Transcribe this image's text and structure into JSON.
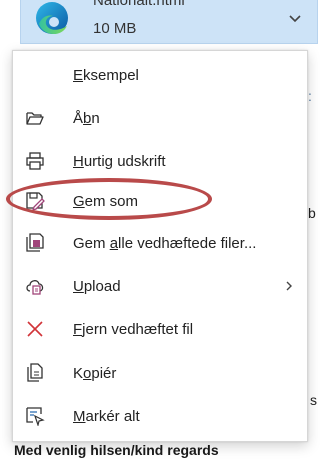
{
  "attachment": {
    "file_name": "Nationalt.html",
    "file_size": "10 MB",
    "icon": "edge-icon",
    "chevron": "chevron-down-icon"
  },
  "background": {
    "fragments": [
      "b",
      ":",
      "s"
    ],
    "signature": "Med venlig hilsen/kind regards"
  },
  "menu": {
    "items": [
      {
        "pre": "",
        "u": "E",
        "post": "ksempel",
        "icon": ""
      },
      {
        "pre": "Å",
        "u": "b",
        "post": "n",
        "icon": "folder-open-icon"
      },
      {
        "pre": "",
        "u": "H",
        "post": "urtig udskrift",
        "icon": "printer-icon"
      },
      {
        "pre": "",
        "u": "G",
        "post": "em som",
        "icon": "save-as-icon"
      },
      {
        "pre": "Gem ",
        "u": "a",
        "post": "lle vedhæftede filer...",
        "icon": "save-all-icon"
      },
      {
        "pre": "",
        "u": "U",
        "post": "pload",
        "icon": "upload-icon",
        "submenu": true
      },
      {
        "pre": "",
        "u": "F",
        "post": "jern vedhæftet fil",
        "icon": "remove-icon"
      },
      {
        "pre": "K",
        "u": "o",
        "post": "piér",
        "icon": "copy-icon"
      },
      {
        "pre": "",
        "u": "M",
        "post": "arkér alt",
        "icon": "select-all-icon"
      }
    ]
  },
  "colors": {
    "annotation": "#b94a4a",
    "attachment_bg": "#cde3f7",
    "remove_icon": "#d13438",
    "save_icon_accent": "#a0457a"
  }
}
